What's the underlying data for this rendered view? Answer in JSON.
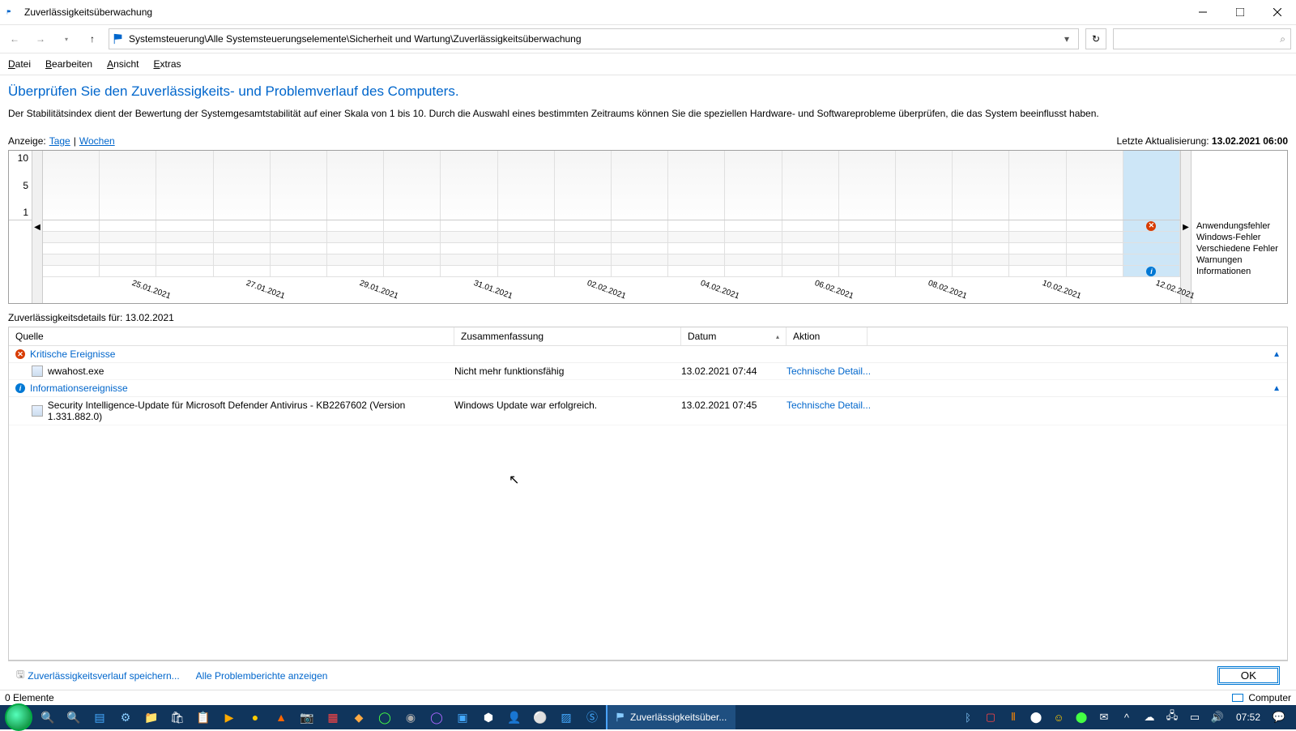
{
  "window": {
    "title": "Zuverlässigkeitsüberwachung"
  },
  "breadcrumb": {
    "path": "Systemsteuerung\\Alle Systemsteuerungselemente\\Sicherheit und Wartung\\Zuverlässigkeitsüberwachung"
  },
  "menu": {
    "file": "Datei",
    "file_u": "D",
    "edit": "Bearbeiten",
    "edit_u": "B",
    "view": "Ansicht",
    "view_u": "A",
    "extras": "Extras",
    "extras_u": "E"
  },
  "page": {
    "title": "Überprüfen Sie den Zuverlässigkeits- und Problemverlauf des Computers.",
    "desc": "Der Stabilitätsindex dient der Bewertung der Systemgesamtstabilität auf einer Skala von 1 bis 10. Durch die Auswahl eines bestimmten Zeitraums können Sie die speziellen Hardware- und Softwareprobleme überprüfen, die das System beeinflusst haben."
  },
  "view": {
    "label": "Anzeige:",
    "days": "Tage",
    "weeks": "Wochen",
    "sep": " | ",
    "lastupd_label": "Letzte Aktualisierung: ",
    "lastupd_value": "13.02.2021 06:00"
  },
  "chart_data": {
    "type": "reliability-timeline",
    "y_ticks": [
      "10",
      "5",
      "1"
    ],
    "dates": [
      "",
      "25.01.2021",
      "",
      "27.01.2021",
      "",
      "29.01.2021",
      "",
      "31.01.2021",
      "",
      "02.02.2021",
      "",
      "04.02.2021",
      "",
      "06.02.2021",
      "",
      "08.02.2021",
      "",
      "10.02.2021",
      "",
      "12.02.2021"
    ],
    "legend": [
      "Anwendungsfehler",
      "Windows-Fehler",
      "Verschiedene Fehler",
      "Warnungen",
      "Informationen"
    ],
    "selected_col": 19,
    "markers": {
      "app_errors_col": 19,
      "info_col": 19
    }
  },
  "details": {
    "header_prefix": "Zuverlässigkeitsdetails für: ",
    "header_date": "13.02.2021",
    "columns": {
      "c1": "Quelle",
      "c2": "Zusammenfassung",
      "c3": "Datum",
      "c4": "Aktion"
    },
    "groups": [
      {
        "icon": "error",
        "title": "Kritische Ereignisse",
        "rows": [
          {
            "source": "wwahost.exe",
            "summary": "Nicht mehr funktionsfähig",
            "date": "13.02.2021 07:44",
            "action": "Technische Detail..."
          }
        ]
      },
      {
        "icon": "info",
        "title": "Informationsereignisse",
        "rows": [
          {
            "source": "Security Intelligence-Update für Microsoft Defender Antivirus - KB2267602 (Version 1.331.882.0)",
            "summary": "Windows Update war erfolgreich.",
            "date": "13.02.2021 07:45",
            "action": "Technische Detail..."
          }
        ]
      }
    ]
  },
  "footer": {
    "save": "Zuverlässigkeitsverlauf speichern...",
    "reports": "Alle Problemberichte anzeigen",
    "ok": "OK"
  },
  "status": {
    "items": "0 Elemente",
    "location": "Computer"
  },
  "taskbar": {
    "active": "Zuverlässigkeitsüber...",
    "clock": "07:52"
  }
}
